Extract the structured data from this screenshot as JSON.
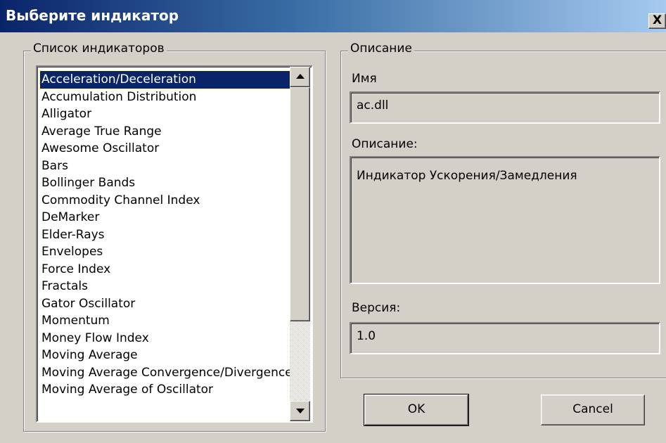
{
  "window": {
    "title": "Выберите индикатор",
    "close_label": "X"
  },
  "list_group": {
    "legend": "Список индикаторов",
    "selected_index": 0,
    "items": [
      "Acceleration/Deceleration",
      "Accumulation Distribution",
      "Alligator",
      "Average True Range",
      "Awesome Oscillator",
      "Bars",
      "Bollinger Bands",
      "Commodity Channel Index",
      "DeMarker",
      "Elder-Rays",
      "Envelopes",
      "Force Index",
      "Fractals",
      "Gator Oscillator",
      "Momentum",
      "Money Flow Index",
      "Moving Average",
      "Moving Average Convergence/Divergence",
      "Moving Average of Oscillator"
    ]
  },
  "description_group": {
    "legend": "Описание",
    "name_label": "Имя",
    "name_value": "ac.dll",
    "description_label": "Описание:",
    "description_value": "Индикатор Ускорения/Замедления",
    "version_label": "Версия:",
    "version_value": "1.0"
  },
  "buttons": {
    "ok_label": "OK",
    "cancel_label": "Cancel"
  },
  "colors": {
    "title_bar_start": "#0a246a",
    "title_bar_end": "#a6caf0",
    "selection": "#0a246a",
    "dialog_bg": "#d4d0c8"
  }
}
